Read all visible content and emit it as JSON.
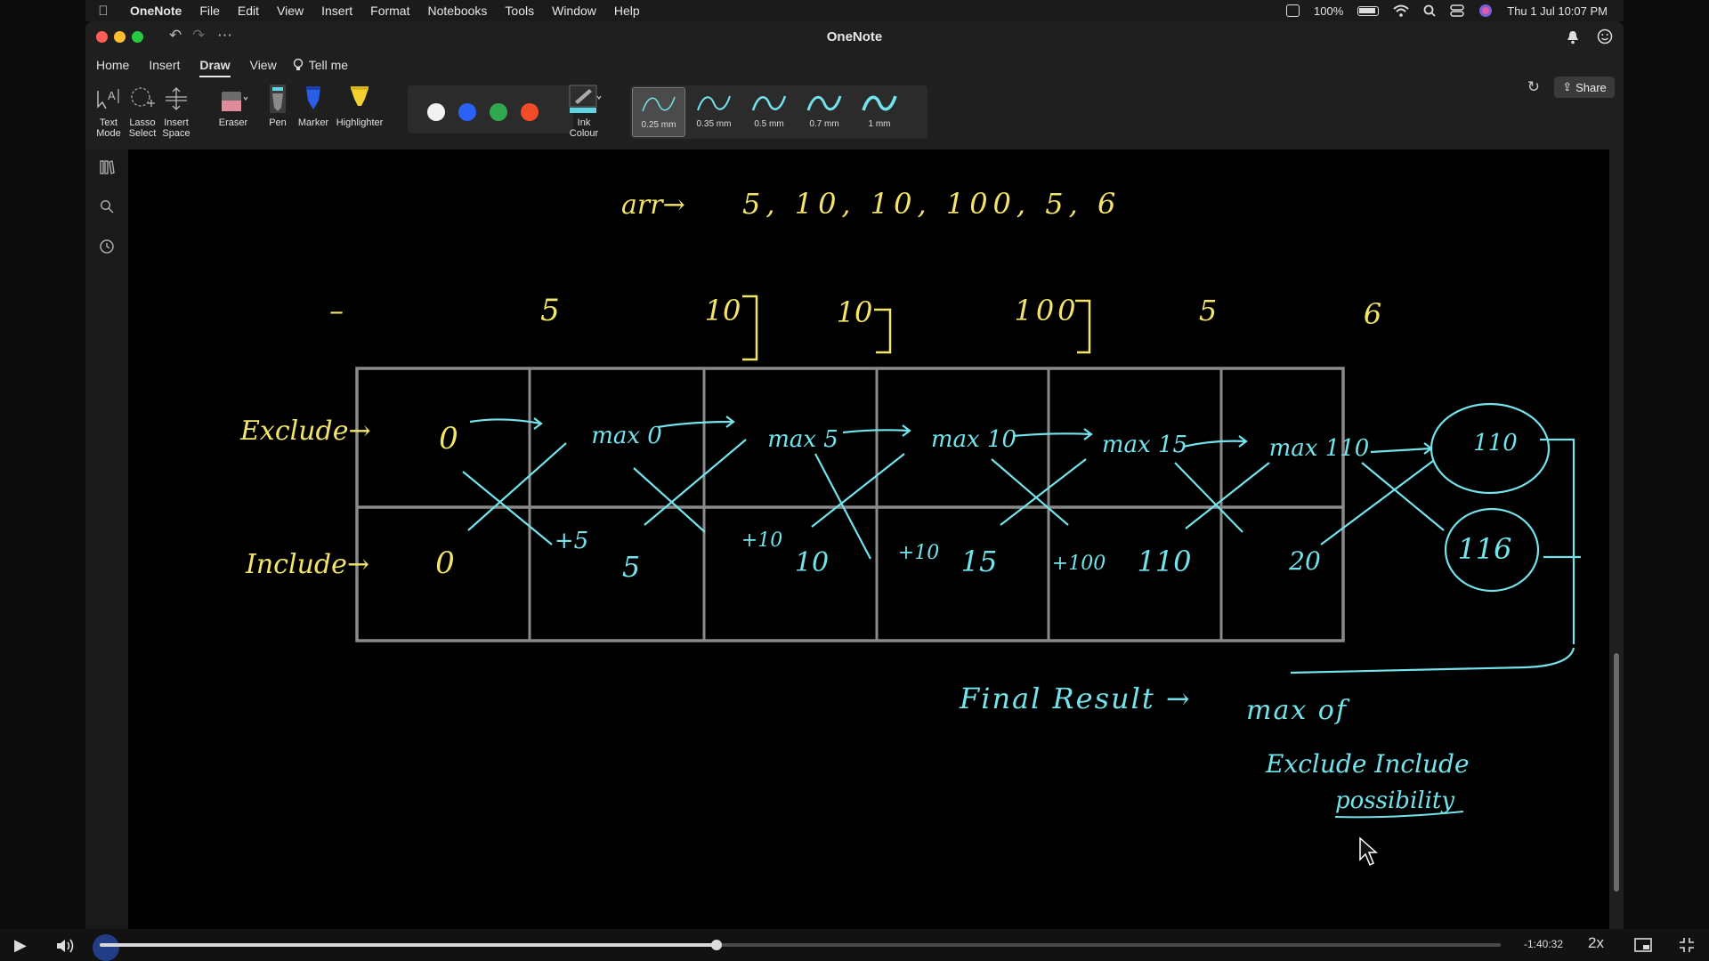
{
  "menubar": {
    "app": "OneNote",
    "items": [
      "File",
      "Edit",
      "View",
      "Insert",
      "Format",
      "Notebooks",
      "Tools",
      "Window",
      "Help"
    ],
    "battery": "100%",
    "clock": "Thu 1 Jul  10:07 PM"
  },
  "window": {
    "title": "OneNote"
  },
  "tabs": [
    "Home",
    "Insert",
    "Draw",
    "View"
  ],
  "active_tab": "Draw",
  "tell_me": "Tell me",
  "share_label": "Share",
  "ribbon": {
    "text_mode": [
      "Text",
      "Mode"
    ],
    "lasso": [
      "Lasso",
      "Select"
    ],
    "insert_space": [
      "Insert",
      "Space"
    ],
    "eraser": "Eraser",
    "pen": "Pen",
    "marker": "Marker",
    "highlighter": "Highlighter",
    "ink_colour": [
      "Ink",
      "Colour"
    ],
    "ink_colors": [
      "#f2f2f2",
      "#2962f5",
      "#2fa84f",
      "#f24b2a"
    ],
    "pen_sizes": [
      "0.25 mm",
      "0.35 mm",
      "0.5 mm",
      "0.7 mm",
      "1 mm"
    ],
    "selected_pen_size": "0.25 mm"
  },
  "note": {
    "ink_yellow": "#f3e46a",
    "ink_cyan": "#73e3ec",
    "array_label": "arr→",
    "array_values": "5, 10, 10, 100, 5, 6",
    "column_headers": [
      "–",
      "5",
      "10",
      "10",
      "100",
      "5",
      "6"
    ],
    "row_labels": [
      "Exclude→",
      "Include→"
    ],
    "exclude_row": [
      "0",
      "max 0",
      "max 5",
      "max 10",
      "max 15",
      "max 110",
      "110"
    ],
    "include_row": [
      "0",
      "5",
      "10",
      "15",
      "110",
      "20",
      "116"
    ],
    "increments": [
      "+5",
      "+10",
      "+10",
      "+100"
    ],
    "final_result": "Final Result →",
    "max_of": "max of",
    "possibility": [
      "Exclude Include",
      "possibility"
    ]
  },
  "player": {
    "time_remaining": "-1:40:32",
    "speed": "2x",
    "progress": 0.44
  }
}
